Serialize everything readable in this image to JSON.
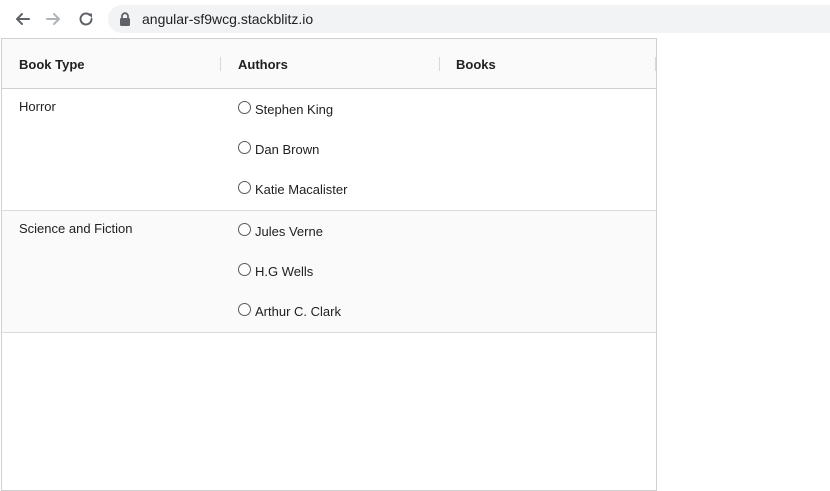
{
  "browser": {
    "url": "angular-sf9wcg.stackblitz.io",
    "icons": [
      "back-arrow-icon",
      "forward-arrow-icon",
      "reload-icon",
      "lock-icon"
    ]
  },
  "table": {
    "headers": {
      "book_type": "Book Type",
      "authors": "Authors",
      "books": "Books"
    },
    "groups": [
      {
        "type": "Horror",
        "authors": [
          "Stephen King",
          "Dan Brown",
          "Katie Macalister"
        ]
      },
      {
        "type": "Science and Fiction",
        "authors": [
          "Jules Verne",
          "H.G Wells",
          "Arthur C. Clark"
        ]
      }
    ]
  }
}
